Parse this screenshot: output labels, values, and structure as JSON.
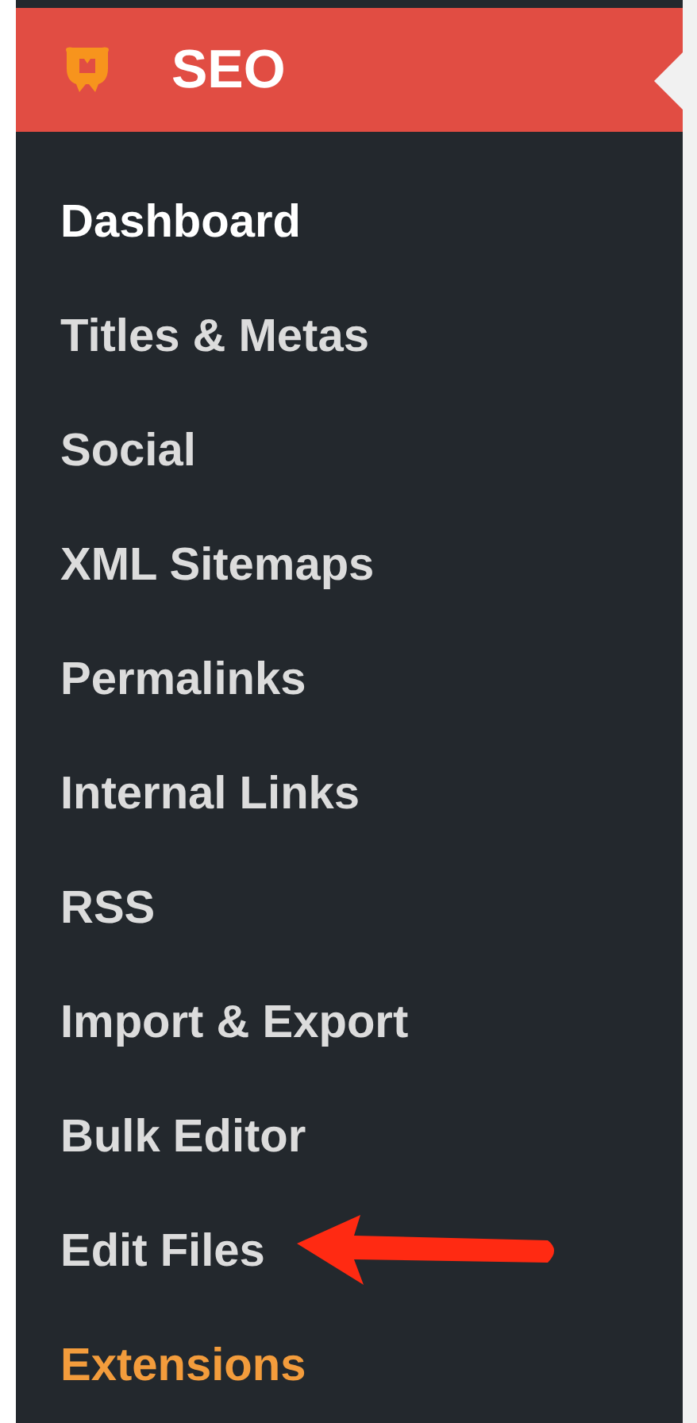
{
  "menu": {
    "title": "SEO",
    "items": [
      {
        "label": "Dashboard",
        "kind": "page",
        "selected": true,
        "arrow": false
      },
      {
        "label": "Titles & Metas",
        "kind": "page",
        "selected": false,
        "arrow": false
      },
      {
        "label": "Social",
        "kind": "page",
        "selected": false,
        "arrow": false
      },
      {
        "label": "XML Sitemaps",
        "kind": "page",
        "selected": false,
        "arrow": false
      },
      {
        "label": "Permalinks",
        "kind": "page",
        "selected": false,
        "arrow": false
      },
      {
        "label": "Internal Links",
        "kind": "page",
        "selected": false,
        "arrow": false
      },
      {
        "label": "RSS",
        "kind": "page",
        "selected": false,
        "arrow": false
      },
      {
        "label": "Import & Export",
        "kind": "page",
        "selected": false,
        "arrow": false
      },
      {
        "label": "Bulk Editor",
        "kind": "page",
        "selected": false,
        "arrow": false
      },
      {
        "label": "Edit Files",
        "kind": "page",
        "selected": false,
        "arrow": true
      },
      {
        "label": "Extensions",
        "kind": "extension",
        "selected": false,
        "arrow": false
      }
    ]
  }
}
